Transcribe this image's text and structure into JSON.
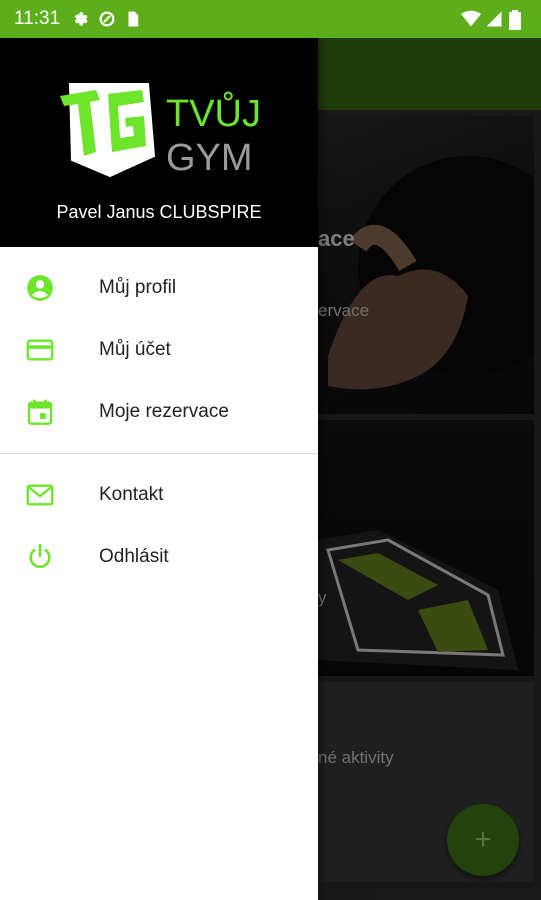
{
  "status_bar": {
    "time": "11:31",
    "left_icons": [
      "gear-icon",
      "data-saver-icon",
      "sim-card-icon"
    ],
    "right_icons": [
      "wifi-icon",
      "signal-icon",
      "battery-icon"
    ]
  },
  "background_screen": {
    "card1_title_partial": "ace",
    "card1_subtitle_partial": "ervace",
    "card2_text_partial": "y",
    "card3_text_partial": "né aktivity",
    "fab_label": "+"
  },
  "drawer": {
    "logo": {
      "text_top": "TVŮJ",
      "text_bottom": "GYM"
    },
    "user_name": "Pavel Janus CLUBSPIRE",
    "items": [
      {
        "label": "Můj profil",
        "icon": "account-circle-icon"
      },
      {
        "label": "Můj účet",
        "icon": "credit-card-icon"
      },
      {
        "label": "Moje rezervace",
        "icon": "calendar-icon"
      }
    ],
    "secondary_items": [
      {
        "label": "Kontakt",
        "icon": "mail-icon"
      },
      {
        "label": "Odhlásit",
        "icon": "power-icon"
      }
    ]
  },
  "colors": {
    "status_bar": "#5cae1a",
    "accent": "#6ce52a",
    "toolbar_dimmed": "#397014"
  }
}
